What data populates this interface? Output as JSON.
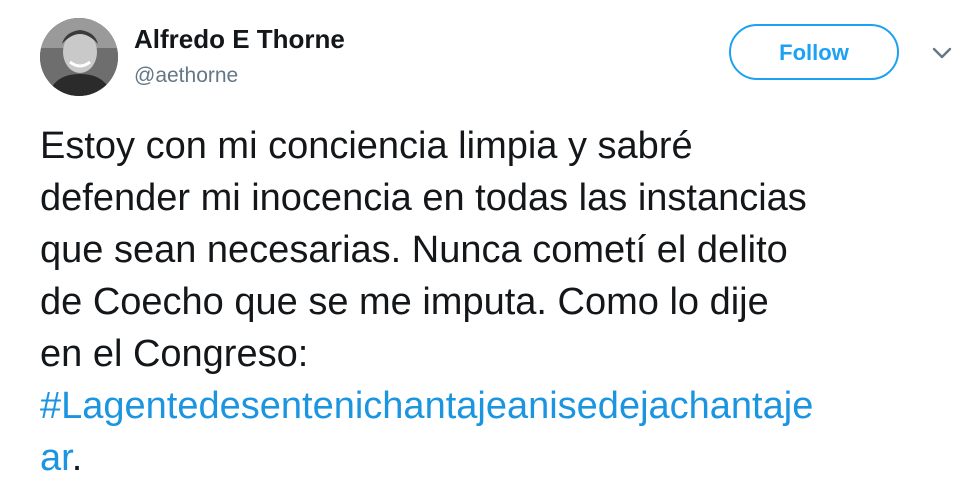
{
  "author": {
    "name": "Alfredo E Thorne",
    "handle": "@aethorne",
    "avatar_icon": "profile-photo"
  },
  "follow_button": {
    "label": "Follow",
    "color": "#1da1f2"
  },
  "menu": {
    "icon": "chevron-down-icon"
  },
  "tweet": {
    "text_lines": [
      "Estoy con mi conciencia limpia y sabré",
      "defender mi inocencia en todas las instancias",
      "que sean necesarias. Nunca cometí el delito",
      "de Coecho que se me imputa. Como lo dije",
      "en el Congreso:"
    ],
    "hashtag_part1": "#Lagentedesentenichantajeanisedejachantaje",
    "hashtag_part2": "ar",
    "trailing": ".",
    "hashtag_color": "#1b95e0"
  }
}
